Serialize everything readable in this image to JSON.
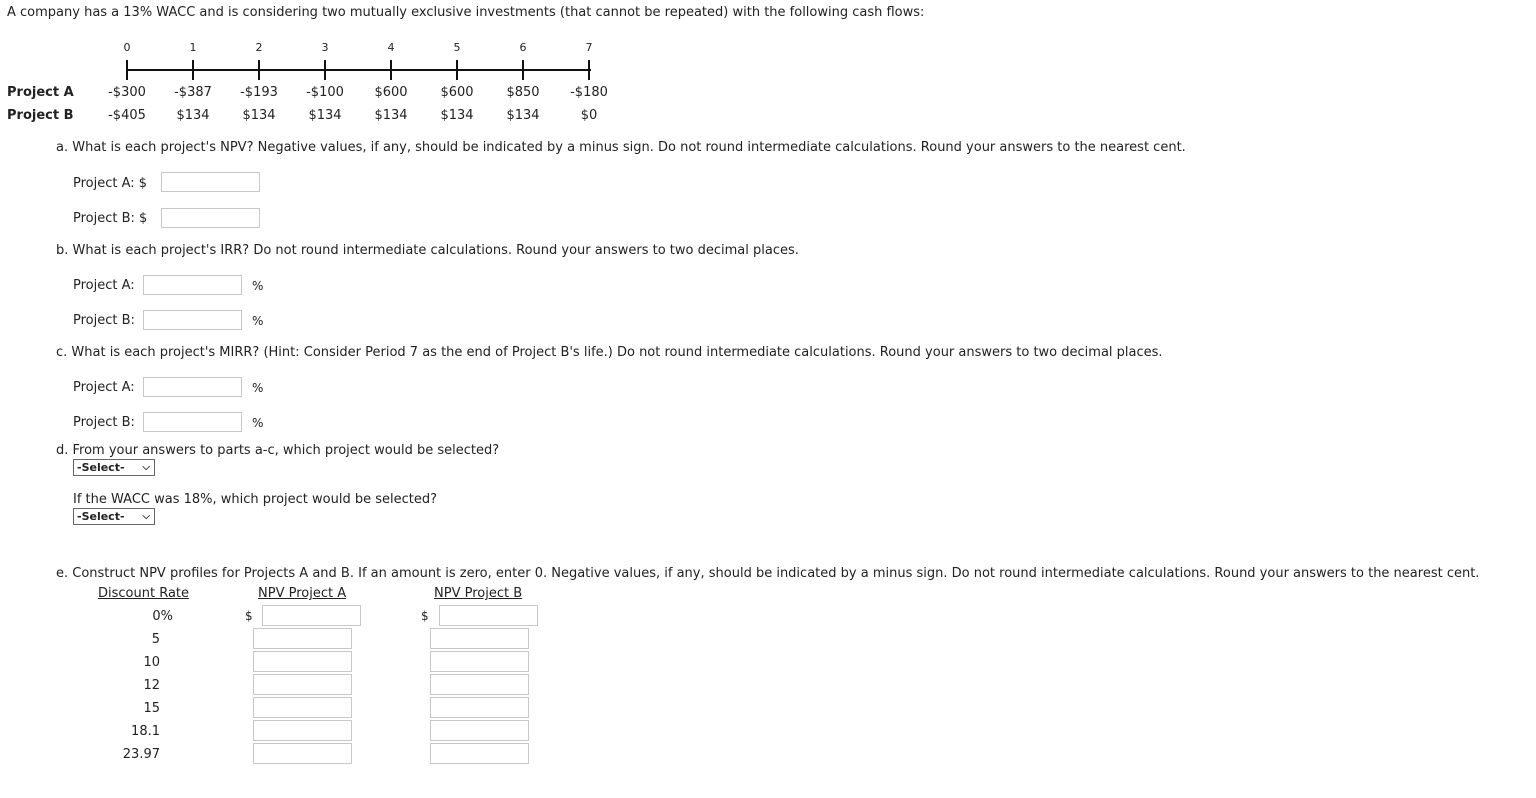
{
  "intro": "A company has a 13% WACC and is considering two mutually exclusive investments (that cannot be repeated) with the following cash flows:",
  "timeline": {
    "periods": [
      "0",
      "1",
      "2",
      "3",
      "4",
      "5",
      "6",
      "7"
    ],
    "projects": [
      {
        "label": "Project A",
        "cash_flows": [
          "-$300",
          "-$387",
          "-$193",
          "-$100",
          "$600",
          "$600",
          "$850",
          "-$180"
        ]
      },
      {
        "label": "Project B",
        "cash_flows": [
          "-$405",
          "$134",
          "$134",
          "$134",
          "$134",
          "$134",
          "$134",
          "$0"
        ]
      }
    ]
  },
  "part_a": {
    "question": "a. What is each project's NPV? Negative values, if any, should be indicated by a minus sign. Do not round intermediate calculations. Round your answers to the nearest cent.",
    "label_a": "Project A: $",
    "label_b": "Project B: $",
    "value_a": "",
    "value_b": ""
  },
  "part_b": {
    "question": "b. What is each project's IRR? Do not round intermediate calculations. Round your answers to two decimal places.",
    "label_a": "Project A:",
    "label_b": "Project B:",
    "unit": "%",
    "value_a": "",
    "value_b": ""
  },
  "part_c": {
    "question": "c. What is each project's MIRR? (Hint: Consider Period 7 as the end of Project B's life.) Do not round intermediate calculations. Round your answers to two decimal places.",
    "label_a": "Project A:",
    "label_b": "Project B:",
    "unit": "%",
    "value_a": "",
    "value_b": ""
  },
  "part_d": {
    "question": "d. From your answers to parts a-c, which project would be selected?",
    "select_1": "-Select-",
    "question_2": "If the WACC was 18%, which project would be selected?",
    "select_2": "-Select-"
  },
  "part_e": {
    "question": "e. Construct NPV profiles for Projects A and B. If an amount is zero, enter 0. Negative values, if any, should be indicated by a minus sign. Do not round intermediate calculations. Round your answers to the nearest cent.",
    "headers": [
      "Discount Rate",
      "NPV Project A",
      "NPV Project B"
    ],
    "currency": "$",
    "rows": [
      {
        "rate": "0%",
        "npv_a": "",
        "npv_b": ""
      },
      {
        "rate": "5",
        "npv_a": "",
        "npv_b": ""
      },
      {
        "rate": "10",
        "npv_a": "",
        "npv_b": ""
      },
      {
        "rate": "12",
        "npv_a": "",
        "npv_b": ""
      },
      {
        "rate": "15",
        "npv_a": "",
        "npv_b": ""
      },
      {
        "rate": "18.1",
        "npv_a": "",
        "npv_b": ""
      },
      {
        "rate": "23.97",
        "npv_a": "",
        "npv_b": ""
      }
    ]
  }
}
